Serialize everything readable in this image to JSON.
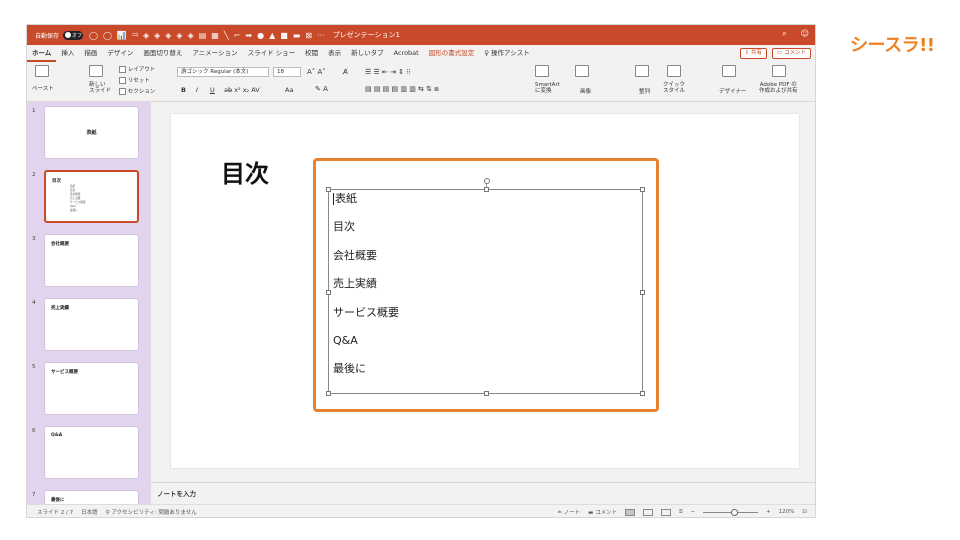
{
  "brand": {
    "logo_text": "シースラ!!"
  },
  "titlebar": {
    "autosave_label": "自動保存",
    "autosave_state": "オフ",
    "doc_title": "プレゼンテーション1",
    "more_symbol": "···",
    "search_icon": "search-icon",
    "share_icon": "person-icon"
  },
  "menu": {
    "tabs": [
      "ホーム",
      "挿入",
      "描画",
      "デザイン",
      "画面切り替え",
      "アニメーション",
      "スライド ショー",
      "校閲",
      "表示",
      "新しいタブ",
      "Acrobat",
      "図形の書式設定",
      "操作アシスト"
    ],
    "share_label": "共有",
    "comment_label": "コメント"
  },
  "ribbon": {
    "paste": "ペースト",
    "new_slide": "新しい\nスライド",
    "layout": "レイアウト",
    "reset": "リセット",
    "section": "セクション",
    "font_name": "游ゴシック Regular (本文)",
    "font_size": "18",
    "bold": "B",
    "italic": "I",
    "underline": "U",
    "aa": "Aa",
    "smartart": "SmartArt\nに変換",
    "image": "画像",
    "arrange": "整列",
    "quick_style": "クイック\nスタイル",
    "designer": "デザイナー",
    "adobe": "Adobe PDF の\n作成および共有"
  },
  "slides": [
    {
      "number": "1",
      "title": "表紙"
    },
    {
      "number": "2",
      "title": "目次",
      "items": [
        "表紙",
        "目次",
        "会社概要",
        "売上実績",
        "サービス概要",
        "Q&A",
        "最後に"
      ]
    },
    {
      "number": "3",
      "title": "会社概要"
    },
    {
      "number": "4",
      "title": "売上実績"
    },
    {
      "number": "5",
      "title": "サービス概要"
    },
    {
      "number": "6",
      "title": "Q&A"
    },
    {
      "number": "7",
      "title": "最後に"
    }
  ],
  "current_slide": {
    "title": "目次",
    "items": [
      "表紙",
      "目次",
      "会社概要",
      "売上実績",
      "サービス概要",
      "Q&A",
      "最後に"
    ]
  },
  "notes": {
    "placeholder": "ノートを入力"
  },
  "status": {
    "slide_info": "スライド 2 / 7",
    "language": "日本語",
    "accessibility": "アクセシビリティ: 問題ありません",
    "notes_btn": "ノート",
    "comments_btn": "コメント",
    "zoom": "120%"
  }
}
